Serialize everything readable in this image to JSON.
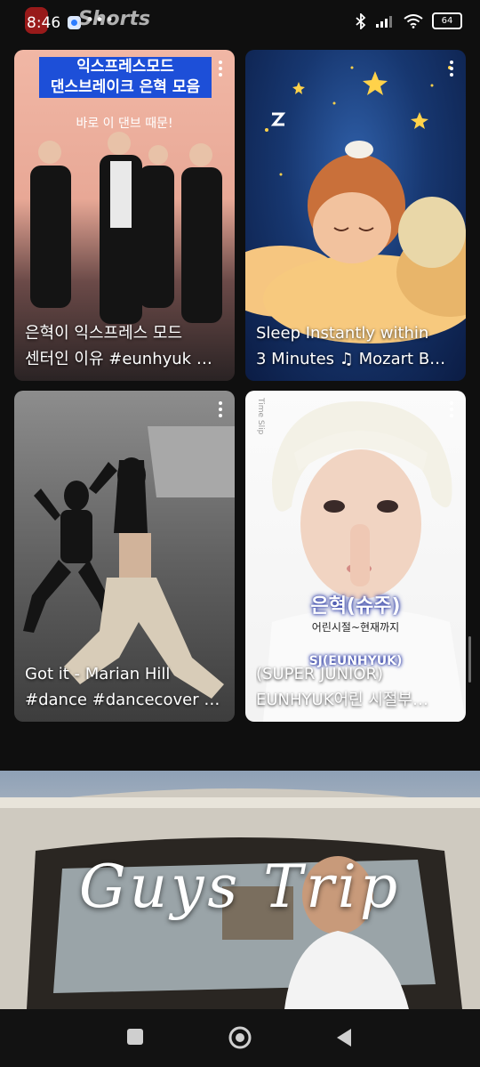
{
  "status_bar": {
    "time": "8:46",
    "more": "•••",
    "battery": "64",
    "icons": [
      "bluetooth-icon",
      "signal-icon",
      "wifi-icon",
      "battery-icon"
    ]
  },
  "app": {
    "title": "Shorts"
  },
  "cards": [
    {
      "banner_line1": "익스프레스모드",
      "banner_line2": "댄스브레이크 은혁 모음",
      "banner_sub": "바로 이 댄브 때문!",
      "caption_line1": "은혁이 익스프레스 모드",
      "caption_line2": "센터인 이유 #eunhyuk …"
    },
    {
      "caption_line1": "Sleep Instantly within",
      "caption_line2": "3 Minutes ♫ Mozart B…"
    },
    {
      "caption_line1": "Got it - Marian Hill",
      "caption_line2": "#dance #dancecover …"
    },
    {
      "side_text": "Time Slip",
      "overlay_title": "은혁(슈주)",
      "overlay_sub": "어린시절~현재까지",
      "overlay_name": "SJ(EUNHYUK)",
      "caption_line1": "(SUPER JUNIOR)",
      "caption_line2": "EUNHYUK어린 시절부…"
    }
  ],
  "bottom_video": {
    "title": "Guys Trip"
  },
  "colors": {
    "background": "#0f0f0f",
    "banner_blue": "#1d4fd8"
  }
}
